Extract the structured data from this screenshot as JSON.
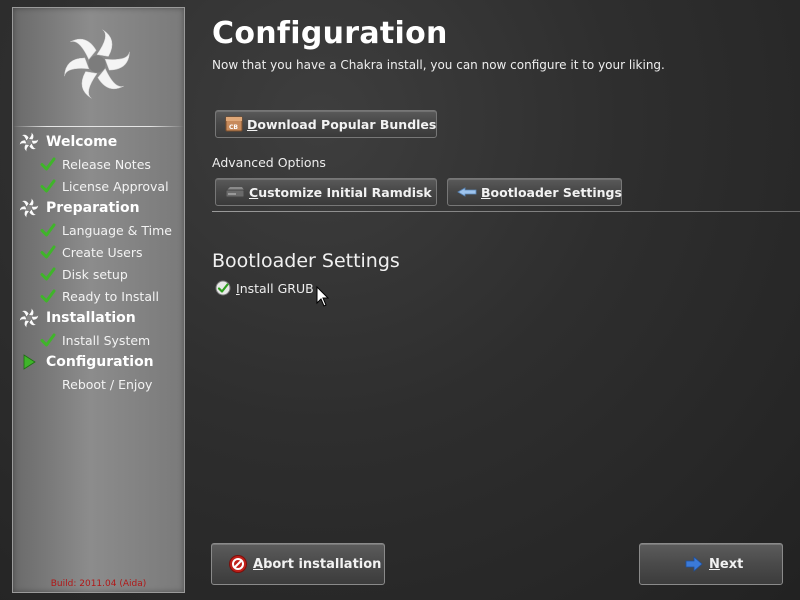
{
  "sidebar": {
    "steps": [
      {
        "label": "Welcome",
        "level": "main",
        "state": "done"
      },
      {
        "label": "Release Notes",
        "level": "sub",
        "state": "done"
      },
      {
        "label": "License Approval",
        "level": "sub",
        "state": "done"
      },
      {
        "label": "Preparation",
        "level": "main",
        "state": "done"
      },
      {
        "label": "Language & Time",
        "level": "sub",
        "state": "done"
      },
      {
        "label": "Create Users",
        "level": "sub",
        "state": "done"
      },
      {
        "label": "Disk setup",
        "level": "sub",
        "state": "done"
      },
      {
        "label": "Ready to Install",
        "level": "sub",
        "state": "done"
      },
      {
        "label": "Installation",
        "level": "main",
        "state": "done"
      },
      {
        "label": "Install System",
        "level": "sub",
        "state": "done"
      },
      {
        "label": "Configuration",
        "level": "main",
        "state": "current"
      },
      {
        "label": "Reboot / Enjoy",
        "level": "sub",
        "state": "pending"
      }
    ],
    "build": "Build: 2011.04 (Aida)"
  },
  "main": {
    "title": "Configuration",
    "subtitle": "Now that you have a Chakra install, you can now configure it to your liking.",
    "bundles_button": {
      "accel": "D",
      "rest": "ownload Popular Bundles"
    },
    "advanced_label": "Advanced Options",
    "ramdisk_button": {
      "accel": "C",
      "rest": "ustomize Initial Ramdisk"
    },
    "bootloader_button": {
      "accel": "B",
      "rest": "ootloader Settings"
    },
    "section_title": "Bootloader Settings",
    "install_grub": {
      "accel": "I",
      "rest": "nstall GRUB",
      "checked": true
    }
  },
  "footer": {
    "abort_button": {
      "accel": "A",
      "rest": "bort installation"
    },
    "next_button": {
      "accel": "N",
      "rest": "ext"
    }
  },
  "colors": {
    "check_green": "#3fb52a",
    "arrow_green": "#3fb52a",
    "build_red": "#b01818",
    "abort_red": "#c0201a",
    "next_blue": "#3b7ad8"
  },
  "icons": {
    "logo": "chakra-logo",
    "step_main": "chakra-mini-icon",
    "step_done": "checkmark-icon",
    "step_current": "arrow-right-icon",
    "bundles": "cd-box-icon",
    "ramdisk": "drive-icon",
    "bootloader": "boot-arrow-icon",
    "abort": "abort-icon",
    "next": "arrow-right-icon"
  }
}
